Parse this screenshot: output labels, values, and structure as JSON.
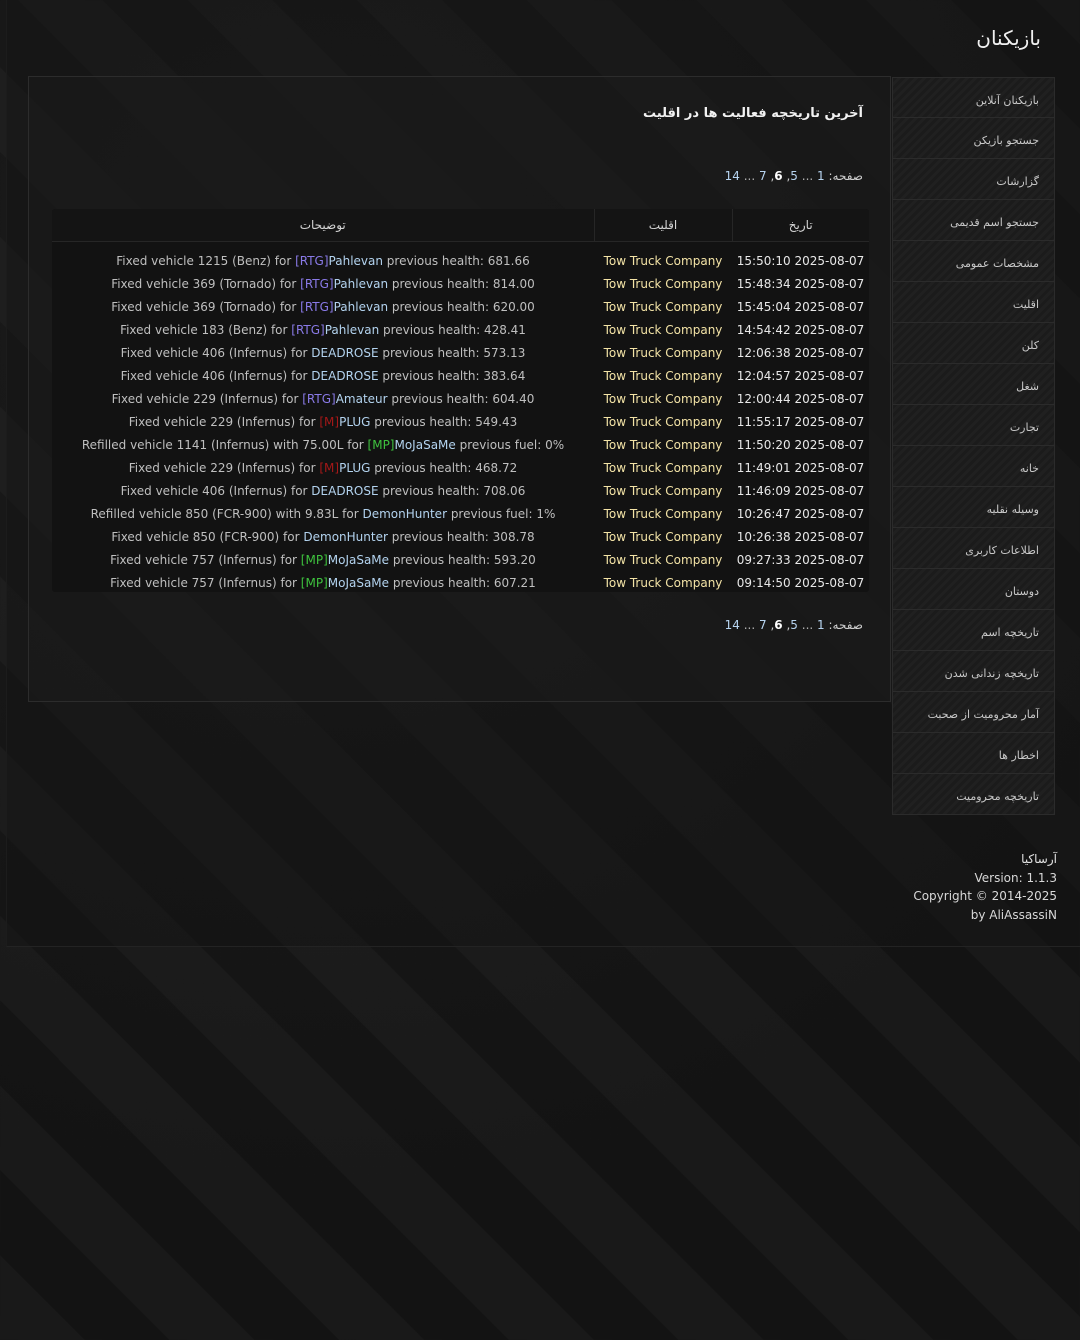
{
  "page": {
    "title": "بازیکنان"
  },
  "sidebar": {
    "items": [
      "بازیکنان آنلاین",
      "جستجو بازیکن",
      "گزارشات",
      "جستجو اسم قدیمی",
      "مشخصات عمومی",
      "اقلیت",
      "کلن",
      "شغل",
      "تجارت",
      "خانه",
      "وسیله نقلیه",
      "اطلاعات کاربری",
      "دوستان",
      "تاریخچه اسم",
      "تاریخچه زندانی شدن",
      "آمار محرومیت از صحبت",
      "اخطار ها",
      "تاریخچه محرومیت"
    ]
  },
  "panel": {
    "heading": "آخرین تاریخچه فعالیت ها در اقلیت",
    "pager": {
      "label": "صفحه:",
      "first": "1",
      "ellipsis": "...",
      "prev": "5",
      "comma": ",",
      "current": "6",
      "next": "7",
      "last": "14"
    },
    "table": {
      "headers": {
        "date": "تاریخ",
        "group": "اقلیت",
        "desc": "توضیحات"
      },
      "rows": [
        {
          "date": "2025-08-07 15:50:10",
          "group": "Tow Truck Company",
          "pre": "Fixed vehicle 1215 (Benz) for ",
          "tag": "[RTG]",
          "tag_color": "purple",
          "name": "Pahlevan",
          "post": " previous health: 681.66"
        },
        {
          "date": "2025-08-07 15:48:34",
          "group": "Tow Truck Company",
          "pre": "Fixed vehicle 369 (Tornado) for ",
          "tag": "[RTG]",
          "tag_color": "purple",
          "name": "Pahlevan",
          "post": " previous health: 814.00"
        },
        {
          "date": "2025-08-07 15:45:04",
          "group": "Tow Truck Company",
          "pre": "Fixed vehicle 369 (Tornado) for ",
          "tag": "[RTG]",
          "tag_color": "purple",
          "name": "Pahlevan",
          "post": " previous health: 620.00"
        },
        {
          "date": "2025-08-07 14:54:42",
          "group": "Tow Truck Company",
          "pre": "Fixed vehicle 183 (Benz) for ",
          "tag": "[RTG]",
          "tag_color": "purple",
          "name": "Pahlevan",
          "post": " previous health: 428.41"
        },
        {
          "date": "2025-08-07 12:06:38",
          "group": "Tow Truck Company",
          "pre": "Fixed vehicle 406 (Infernus) for ",
          "tag": "",
          "tag_color": "",
          "name": "DEADROSE",
          "post": " previous health: 573.13"
        },
        {
          "date": "2025-08-07 12:04:57",
          "group": "Tow Truck Company",
          "pre": "Fixed vehicle 406 (Infernus) for ",
          "tag": "",
          "tag_color": "",
          "name": "DEADROSE",
          "post": " previous health: 383.64"
        },
        {
          "date": "2025-08-07 12:00:44",
          "group": "Tow Truck Company",
          "pre": "Fixed vehicle 229 (Infernus) for ",
          "tag": "[RTG]",
          "tag_color": "purple",
          "name": "Amateur",
          "post": " previous health: 604.40"
        },
        {
          "date": "2025-08-07 11:55:17",
          "group": "Tow Truck Company",
          "pre": "Fixed vehicle 229 (Infernus) for ",
          "tag": "[M]",
          "tag_color": "red",
          "name": "PLUG",
          "post": " previous health: 549.43"
        },
        {
          "date": "2025-08-07 11:50:20",
          "group": "Tow Truck Company",
          "pre": "Refilled vehicle 1141 (Infernus) with 75.00L for ",
          "tag": "[MP]",
          "tag_color": "green",
          "name": "MoJaSaMe",
          "post": " previous fuel: 0%"
        },
        {
          "date": "2025-08-07 11:49:01",
          "group": "Tow Truck Company",
          "pre": "Fixed vehicle 229 (Infernus) for ",
          "tag": "[M]",
          "tag_color": "red",
          "name": "PLUG",
          "post": " previous health: 468.72"
        },
        {
          "date": "2025-08-07 11:46:09",
          "group": "Tow Truck Company",
          "pre": "Fixed vehicle 406 (Infernus) for ",
          "tag": "",
          "tag_color": "",
          "name": "DEADROSE",
          "post": " previous health: 708.06"
        },
        {
          "date": "2025-08-07 10:26:47",
          "group": "Tow Truck Company",
          "pre": "Refilled vehicle 850 (FCR-900) with 9.83L for ",
          "tag": "",
          "tag_color": "",
          "name": "DemonHunter",
          "post": " previous fuel: 1%"
        },
        {
          "date": "2025-08-07 10:26:38",
          "group": "Tow Truck Company",
          "pre": "Fixed vehicle 850 (FCR-900) for ",
          "tag": "",
          "tag_color": "",
          "name": "DemonHunter",
          "post": " previous health: 308.78"
        },
        {
          "date": "2025-08-07 09:27:33",
          "group": "Tow Truck Company",
          "pre": "Fixed vehicle 757 (Infernus) for ",
          "tag": "[MP]",
          "tag_color": "green",
          "name": "MoJaSaMe",
          "post": " previous health: 593.20"
        },
        {
          "date": "2025-08-07 09:14:50",
          "group": "Tow Truck Company",
          "pre": "Fixed vehicle 757 (Infernus) for ",
          "tag": "[MP]",
          "tag_color": "green",
          "name": "MoJaSaMe",
          "post": " previous health: 607.21"
        }
      ]
    }
  },
  "colors": {
    "tag_purple": "#8a7ae8",
    "tag_green": "#3ec23e",
    "tag_red": "#a31818",
    "player_name": "#b3d3ef",
    "group_text": "#f3e3a6"
  },
  "footer": {
    "site": "آرساکیا",
    "version": "Version: 1.1.3",
    "copyright": "Copyright © 2014-2025",
    "author": "by AliAssassiN"
  }
}
